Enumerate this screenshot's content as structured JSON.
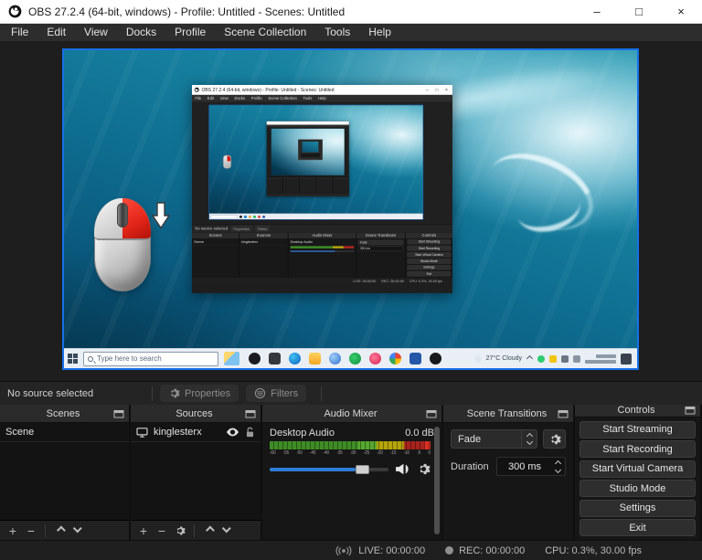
{
  "window": {
    "title": "OBS 27.2.4 (64-bit, windows) - Profile: Untitled - Scenes: Untitled",
    "minimize": "–",
    "maximize": "□",
    "close": "×"
  },
  "menu": {
    "items": [
      "File",
      "Edit",
      "View",
      "Docks",
      "Profile",
      "Scene Collection",
      "Tools",
      "Help"
    ]
  },
  "source_toolbar": {
    "status": "No source selected",
    "properties": "Properties",
    "filters": "Filters"
  },
  "panels": {
    "scenes": {
      "title": "Scenes",
      "item": "Scene"
    },
    "sources": {
      "title": "Sources",
      "item": "kinglesterx"
    },
    "mixer": {
      "title": "Audio Mixer",
      "channel": "Desktop Audio",
      "db": "0.0 dB",
      "ticks": [
        "-60",
        "-55",
        "-50",
        "-45",
        "-40",
        "-35",
        "-30",
        "-25",
        "-20",
        "-15",
        "-10",
        "-5",
        "0"
      ]
    },
    "transitions": {
      "title": "Scene Transitions",
      "selected": "Fade",
      "duration_label": "Duration",
      "duration_value": "300 ms"
    },
    "controls": {
      "title": "Controls",
      "buttons": [
        "Start Streaming",
        "Start Recording",
        "Start Virtual Camera",
        "Studio Mode",
        "Settings",
        "Exit"
      ]
    }
  },
  "statusbar": {
    "live": "LIVE: 00:00:00",
    "rec": "REC: 00:00:00",
    "cpu": "CPU: 0.3%, 30.00 fps"
  },
  "desktop": {
    "search_placeholder": "Type here to search",
    "weather": "27°C Cloudy"
  },
  "icons": {
    "plus": "+",
    "minus": "−"
  },
  "colors": {
    "accent_blue": "#1670e8",
    "meter_green": "#3f8c26",
    "meter_yellow": "#b5a40a",
    "meter_red": "#b0261f",
    "mouse_red": "#e02418",
    "slider_blue": "#2f7cd6"
  }
}
